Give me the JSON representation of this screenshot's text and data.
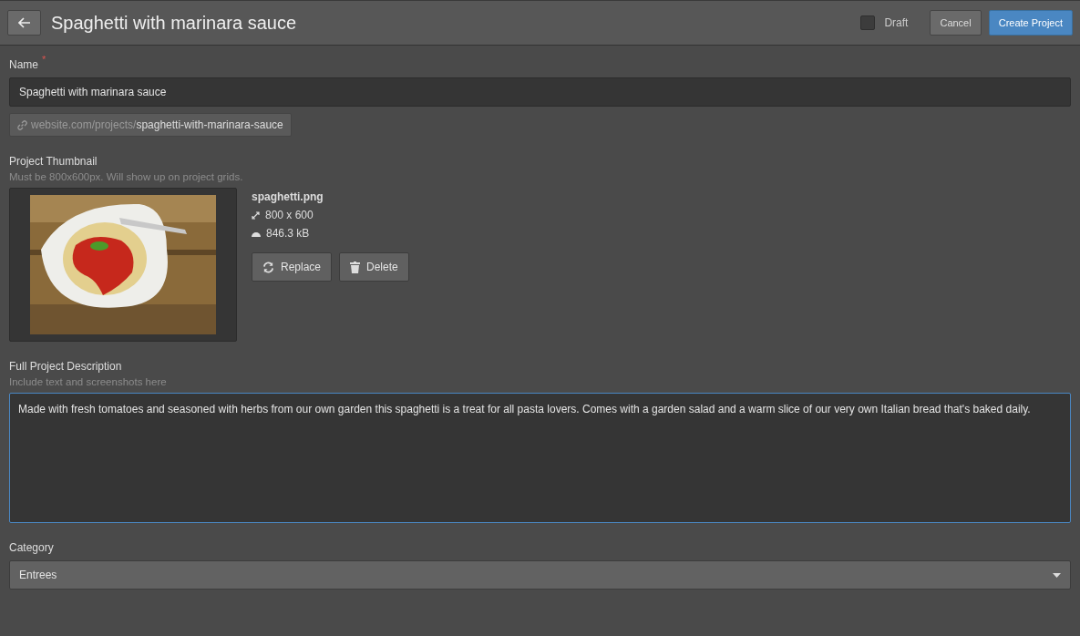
{
  "header": {
    "title": "Spaghetti with marinara sauce",
    "draft": {
      "label": "Draft",
      "checked": false
    },
    "buttons": [
      {
        "label": "Cancel",
        "kind": "secondary"
      },
      {
        "label": "Create Project",
        "kind": "primary"
      }
    ]
  },
  "name_field": {
    "label": "Name",
    "required_mark": "*",
    "value": "Spaghetti with marinara sauce",
    "url": "website.com/projects/**spaghetti-with-marinara-sauce**"
  },
  "thumbnail": {
    "label": "Project Thumbnail",
    "hint": "Must be 800x600px. Will show up on project grids.",
    "file_name": "spaghetti.png",
    "dimensions": "800 x 600",
    "size": "846.3 kB",
    "buttons": [
      {
        "label": "Replace",
        "kind": "replace"
      },
      {
        "label": "Delete",
        "kind": "delete"
      }
    ]
  },
  "description": {
    "label": "Full Project Description",
    "hint": "Include text and screenshots here",
    "value": "Made with fresh tomatoes and seasoned with herbs from our own garden this spaghetti is a treat for all pasta lovers. Comes with a garden salad and a warm slice of our very own Italian bread that's baked daily.",
    "focused": true
  },
  "category": {
    "label": "Category",
    "value": "Entrees"
  }
}
